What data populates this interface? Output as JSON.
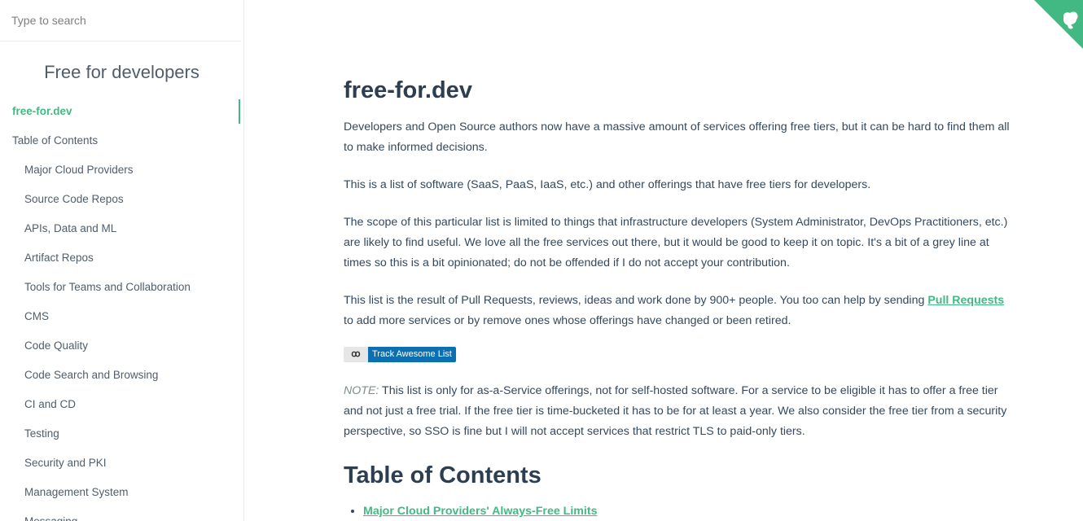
{
  "search": {
    "placeholder": "Type to search"
  },
  "sidebar": {
    "app_name": "Free for developers",
    "items": [
      {
        "label": "free-for.dev"
      },
      {
        "label": "Table of Contents"
      },
      {
        "label": "Major Cloud Providers"
      },
      {
        "label": "Source Code Repos"
      },
      {
        "label": "APIs, Data and ML"
      },
      {
        "label": "Artifact Repos"
      },
      {
        "label": "Tools for Teams and Collaboration"
      },
      {
        "label": "CMS"
      },
      {
        "label": "Code Quality"
      },
      {
        "label": "Code Search and Browsing"
      },
      {
        "label": "CI and CD"
      },
      {
        "label": "Testing"
      },
      {
        "label": "Security and PKI"
      },
      {
        "label": "Management System"
      },
      {
        "label": "Messaging"
      }
    ]
  },
  "main": {
    "title": "free-for.dev",
    "para1": "Developers and Open Source authors now have a massive amount of services offering free tiers, but it can be hard to find them all to make informed decisions.",
    "para2": "This is a list of software (SaaS, PaaS, IaaS, etc.) and other offerings that have free tiers for developers.",
    "para3": "The scope of this particular list is limited to things that infrastructure developers (System Administrator, DevOps Practitioners, etc.) are likely to find useful. We love all the free services out there, but it would be good to keep it on topic. It's a bit of a grey line at times so this is a bit opinionated; do not be offended if I do not accept your contribution.",
    "para4_before": "This list is the result of Pull Requests, reviews, ideas and work done by 900+ people. You too can help by sending ",
    "para4_link": "Pull Requests",
    "para4_after": " to add more services or by remove ones whose offerings have changed or been retired.",
    "badge_logo": "ꝏ",
    "badge_text": "Track Awesome List",
    "note_label": "NOTE:",
    "note_text": " This list is only for as-a-Service offerings, not for self-hosted software. For a service to be eligible it has to offer a free tier and not just a free trial. If the free tier is time-bucketed it has to be for at least a year. We also consider the free tier from a security perspective, so SSO is fine but I will not accept services that restrict TLS to paid-only tiers.",
    "toc_title": "Table of Contents",
    "toc_items": [
      {
        "label": "Major Cloud Providers' Always-Free Limits"
      }
    ]
  },
  "colors": {
    "accent": "#42b983",
    "text": "#34495e",
    "badge": "#0b6fb1"
  },
  "corner": {
    "icon": "github-octocat-icon"
  }
}
